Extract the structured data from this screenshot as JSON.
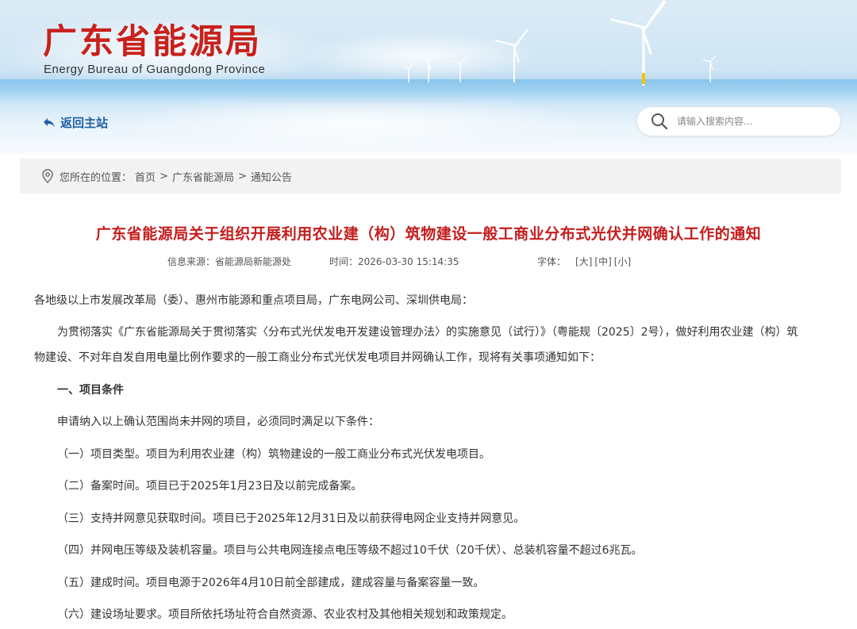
{
  "header": {
    "site_title": "广东省能源局",
    "site_subtitle": "Energy Bureau of Guangdong Province",
    "back_home": "返回主站",
    "search_placeholder": "请输入搜索内容..."
  },
  "breadcrumb": {
    "label": "您所在的位置：",
    "items": [
      "首页",
      "广东省能源局",
      "通知公告"
    ],
    "separator": ">"
  },
  "article": {
    "title": "广东省能源局关于组织开展利用农业建（构）筑物建设一般工商业分布式光伏并网确认工作的通知",
    "source_label": "信息来源：",
    "source": "省能源局新能源处",
    "time_label": "时间：",
    "time": "2026-03-30 15:14:35",
    "font_label": "字体：",
    "font_sizes": [
      "[大]",
      "[中]",
      "[小]"
    ],
    "salutation": "各地级以上市发展改革局（委）、惠州市能源和重点项目局，广东电网公司、深圳供电局：",
    "intro_line1": "为贯彻落实《广东省能源局关于贯彻落实〈分布式光伏发电开发建设管理办法〉的实施意见（试行）》（粤能规〔2025〕2号），做好利用农业建（构）筑",
    "intro_line2": "物建设、不对年自发自用电量比例作要求的一般工商业分布式光伏发电项目并网确认工作，现将有关事项通知如下：",
    "section1_heading": "一、项目条件",
    "section1_lead": "申请纳入以上确认范围尚未并网的项目，必须同时满足以下条件：",
    "conditions": [
      "（一）项目类型。项目为利用农业建（构）筑物建设的一般工商业分布式光伏发电项目。",
      "（二）备案时间。项目已于2025年1月23日及以前完成备案。",
      "（三）支持并网意见获取时间。项目已于2025年12月31日及以前获得电网企业支持并网意见。",
      "（四）并网电压等级及装机容量。项目与公共电网连接点电压等级不超过10千伏（20千伏）、总装机容量不超过6兆瓦。",
      "（五）建成时间。项目电源于2026年4月10日前全部建成，建成容量与备案容量一致。",
      "（六）建设场址要求。项目所依托场址符合自然资源、农业农村及其他相关规划和政策规定。"
    ]
  },
  "colors": {
    "title_red": "#c41d1d",
    "logo_red": "#c8211c",
    "link_blue": "#1f5fa6",
    "breadcrumb_bg": "#f2f2f2"
  }
}
